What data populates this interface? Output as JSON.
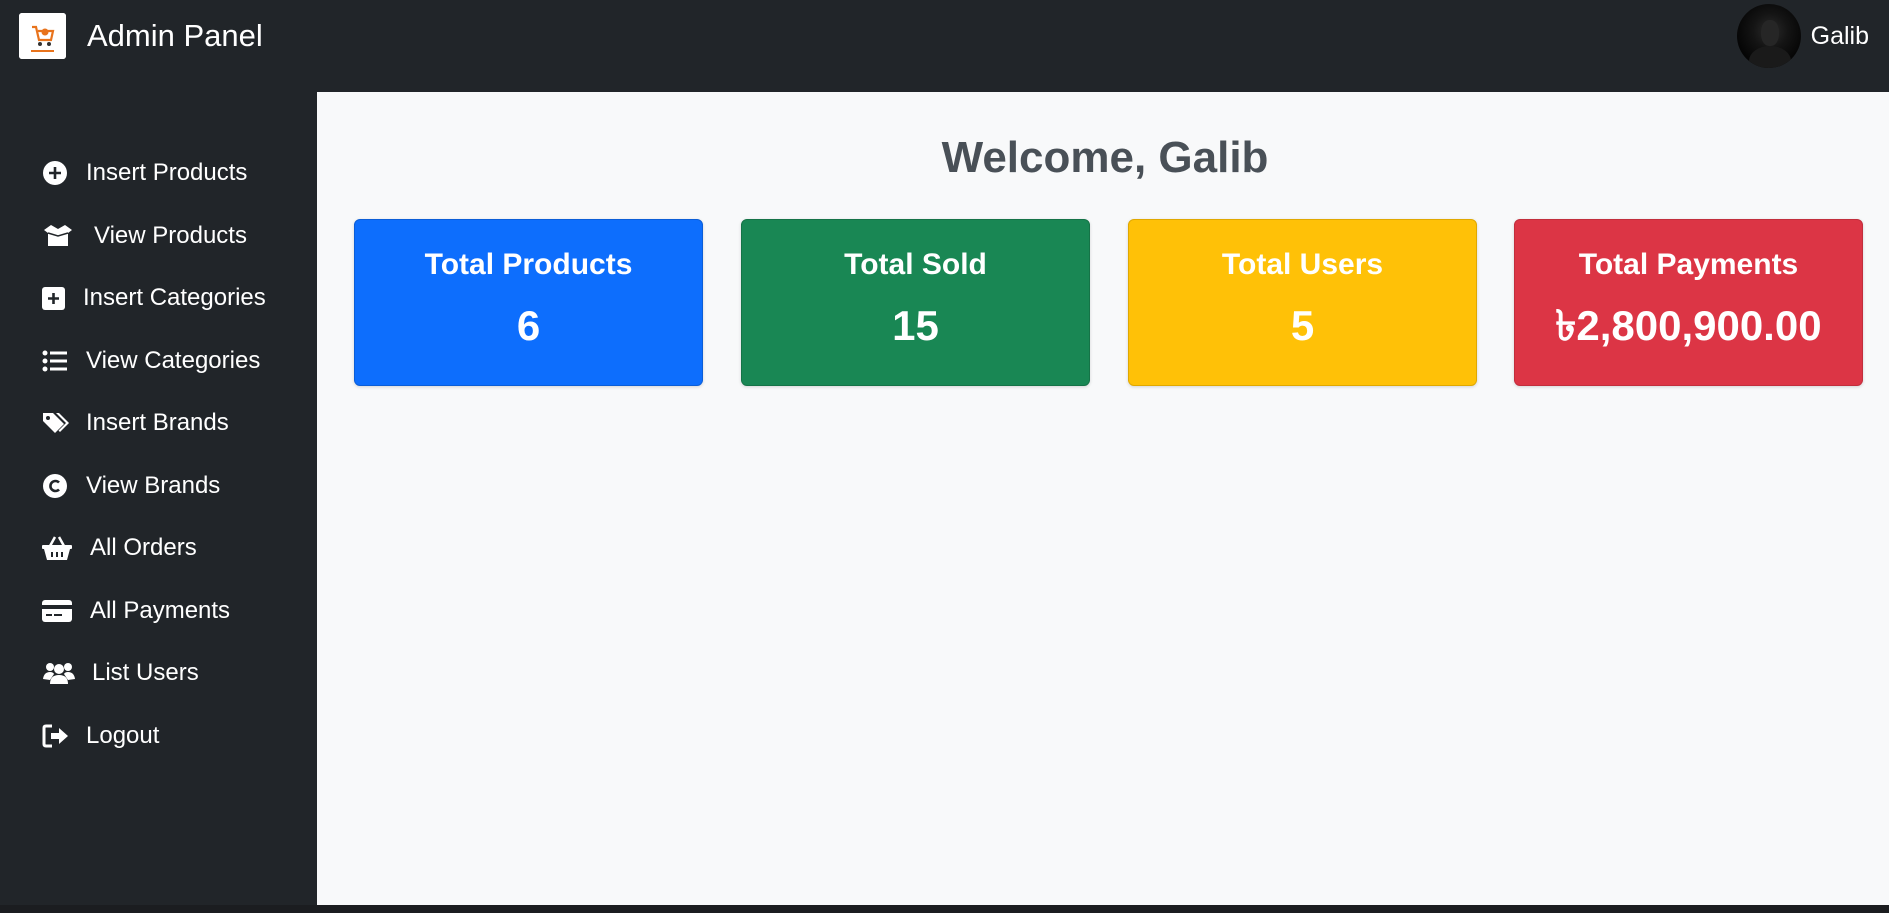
{
  "header": {
    "title": "Admin Panel",
    "user_name": "Galib"
  },
  "sidebar": {
    "items": [
      {
        "label": "Insert Products",
        "icon": "plus-circle-icon"
      },
      {
        "label": "View Products",
        "icon": "box-open-icon"
      },
      {
        "label": "Insert Categories",
        "icon": "plus-square-icon"
      },
      {
        "label": "View Categories",
        "icon": "list-icon"
      },
      {
        "label": "Insert Brands",
        "icon": "tags-icon"
      },
      {
        "label": "View Brands",
        "icon": "copyright-icon"
      },
      {
        "label": "All Orders",
        "icon": "basket-icon"
      },
      {
        "label": "All Payments",
        "icon": "credit-card-icon"
      },
      {
        "label": "List Users",
        "icon": "users-icon"
      },
      {
        "label": "Logout",
        "icon": "logout-icon"
      }
    ]
  },
  "main": {
    "welcome": "Welcome, Galib",
    "cards": [
      {
        "label": "Total Products",
        "value": "6",
        "color": "#0d6efd"
      },
      {
        "label": "Total Sold",
        "value": "15",
        "color": "#198754"
      },
      {
        "label": "Total Users",
        "value": "5",
        "color": "#ffc107"
      },
      {
        "label": "Total Payments",
        "value": "৳2,800,900.00",
        "color": "#dc3545"
      }
    ]
  },
  "colors": {
    "background_dark": "#212529",
    "main_background": "#f8f9fa",
    "welcome_text": "#495057"
  }
}
